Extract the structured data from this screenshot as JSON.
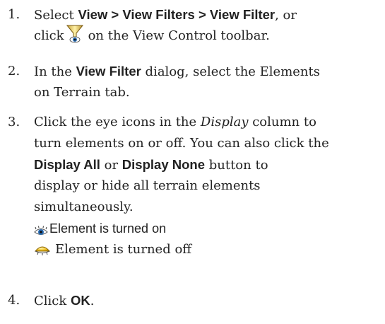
{
  "steps": [
    {
      "number": "1.",
      "line1_prefix": "Select ",
      "line1_bold": "View > View Filters > View Filter",
      "line1_suffix": ", or",
      "line2_prefix": "click",
      "line2_suffix": "on the View Control toolbar.",
      "icon": "view-filter-funnel-icon"
    },
    {
      "number": "2.",
      "line1_prefix": "In the ",
      "line1_bold": "View Filter",
      "line1_suffix": " dialog, select the Elements",
      "line2": "on Terrain tab."
    },
    {
      "number": "3.",
      "line1_prefix": "Click the eye icons in the ",
      "line1_italic": "Display",
      "line1_suffix": " column to",
      "line2": "turn elements on or off. You can also click the",
      "line3_bold1": "Display All",
      "line3_mid": " or ",
      "line3_bold2": "Display None",
      "line3_suffix": " button to",
      "line4": "display or hide all terrain elements",
      "line5": "simultaneously.",
      "legend": [
        {
          "icon": "eye-open-icon",
          "label": "Element is turned on"
        },
        {
          "icon": "eye-closed-icon",
          "label": "Element is turned off"
        }
      ]
    },
    {
      "number": "4.",
      "prefix": "Click ",
      "bold": "OK",
      "suffix": "."
    }
  ],
  "colors": {
    "text": "#222222",
    "eye_on_iris": "#2a6fb8",
    "eye_off_lid": "#e8b400"
  }
}
